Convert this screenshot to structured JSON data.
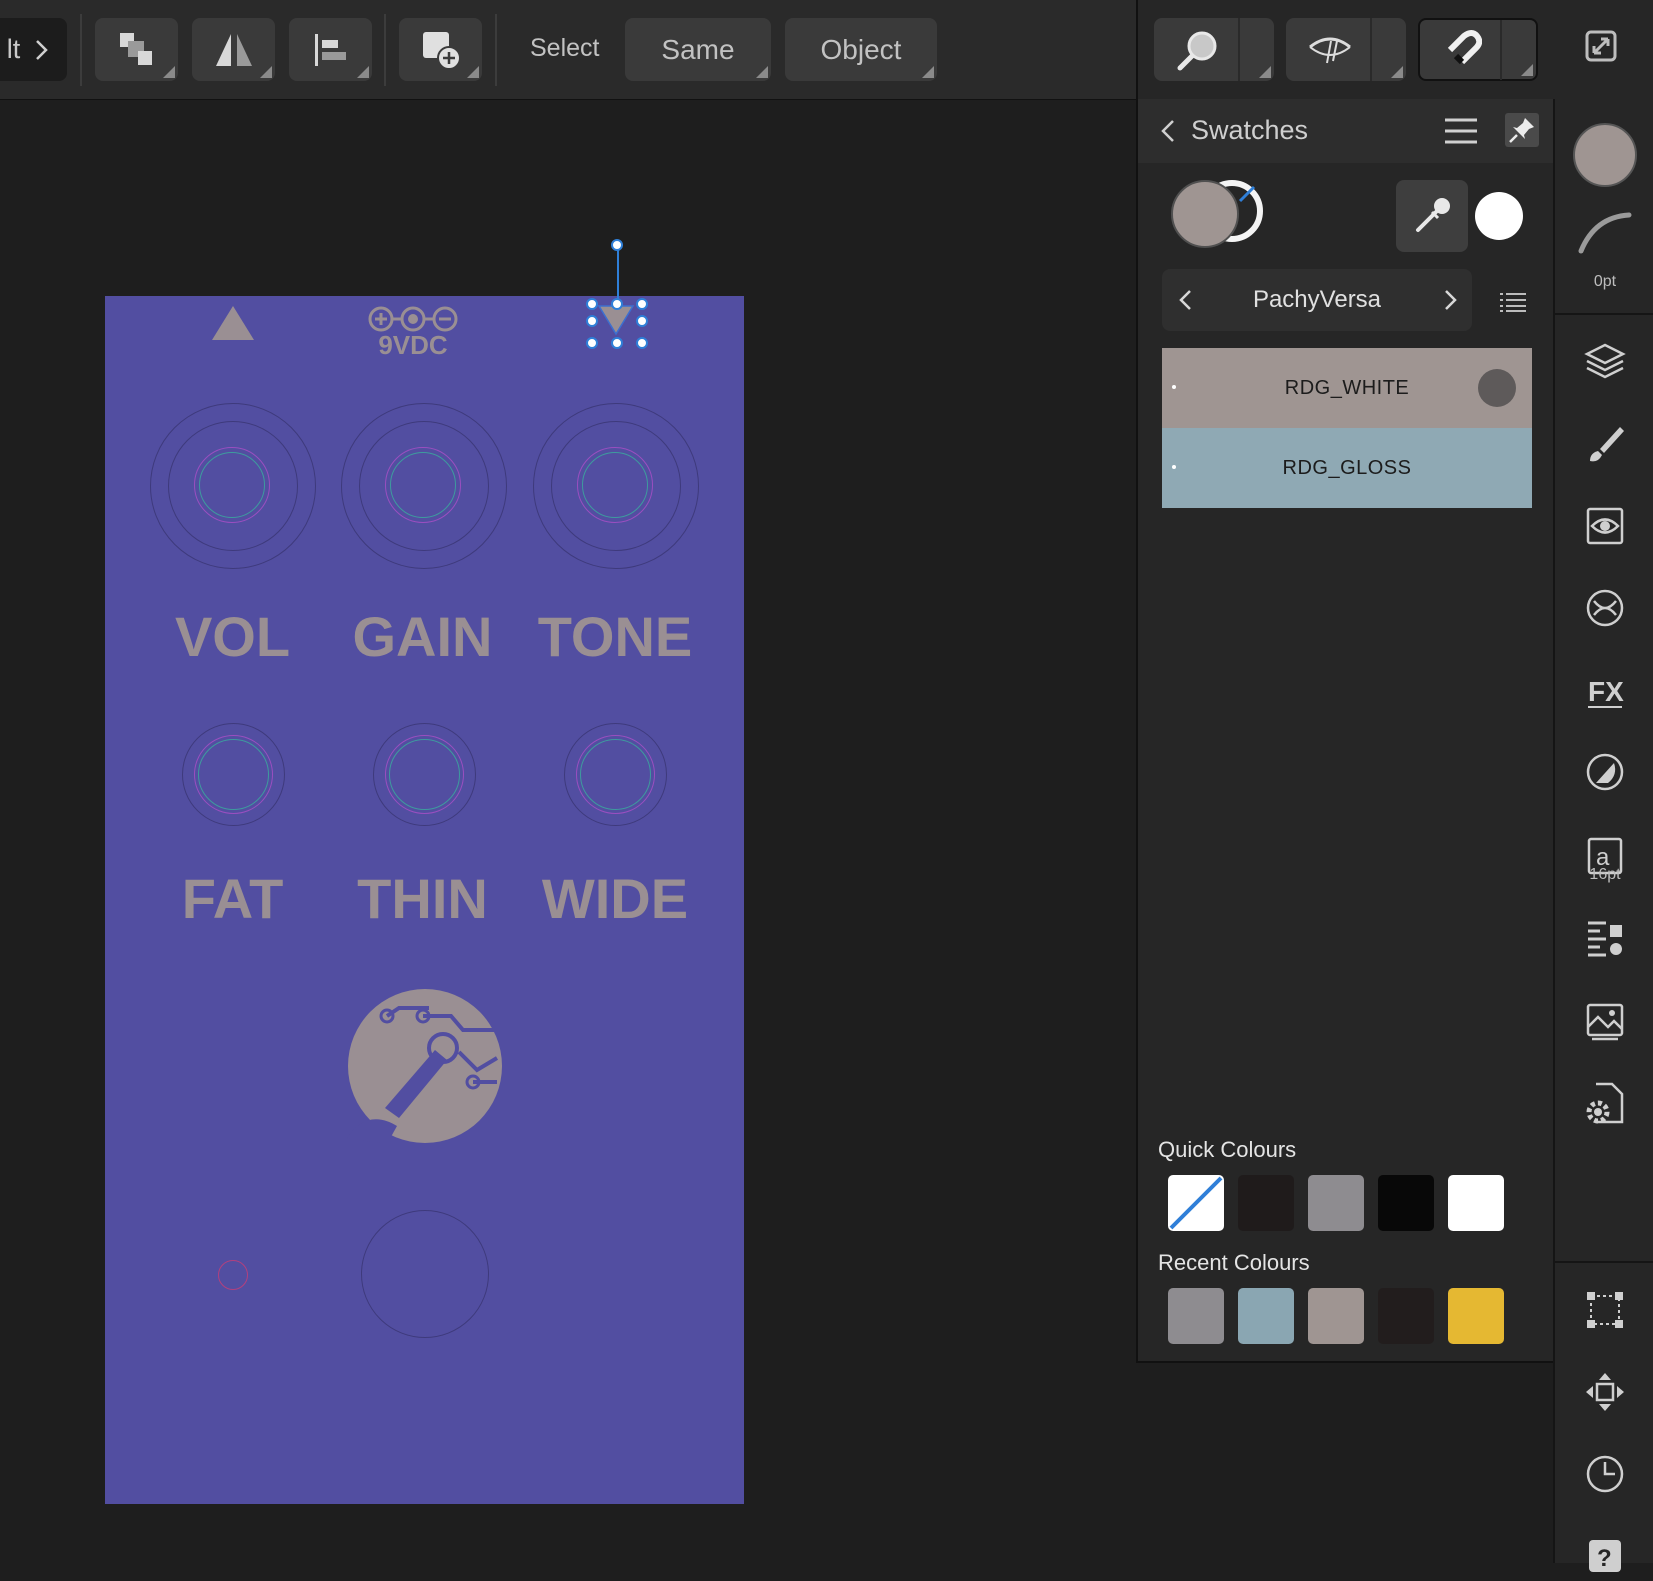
{
  "toolbar": {
    "cut_label": "lt",
    "select_label": "Select",
    "same_label": "Same",
    "object_label": "Object",
    "icons": [
      "chevron-right-icon",
      "arrange-icon",
      "flip-icon",
      "align-left-icon",
      "insert-object-icon"
    ]
  },
  "right_toolbar": {
    "icons": [
      "zoom-icon",
      "view-mode-icon",
      "snapping-magnet-icon",
      "fullscreen-icon"
    ]
  },
  "swatches": {
    "title": "Swatches",
    "palette_name": "PachyVersa",
    "items": [
      {
        "label": "RDG_WHITE",
        "color": "#9f9592"
      },
      {
        "label": "RDG_GLOSS",
        "color": "#8fa9b4"
      }
    ],
    "fill_color": "#9f9592",
    "quick_colours_title": "Quick Colours",
    "quick_colours": [
      "none",
      "#1f1b1b",
      "#8e8c90",
      "#080808",
      "#ffffff"
    ],
    "recent_colours_title": "Recent Colours",
    "recent_colours": [
      "#8e8c90",
      "#8aa6b2",
      "#9f9592",
      "#221d1d",
      "#e5b832"
    ]
  },
  "side_rail": {
    "stroke_width": "0pt",
    "font_size": "16pt",
    "icons": [
      "fill-color-icon",
      "stroke-icon",
      "layers-icon",
      "brushes-icon",
      "adjustments-icon",
      "styles-icon",
      "fx-icon",
      "transparency-icon",
      "text-styles-icon",
      "text-frame-icon",
      "stock-icon",
      "document-settings-icon",
      "transform-icon",
      "move-icon",
      "history-icon",
      "help-icon"
    ]
  },
  "canvas": {
    "artboard_color": "#524ea1",
    "power_label": "9VDC",
    "knob_labels": [
      "VOL",
      "GAIN",
      "TONE"
    ],
    "small_knob_labels": [
      "FAT",
      "THIN",
      "WIDE"
    ]
  }
}
